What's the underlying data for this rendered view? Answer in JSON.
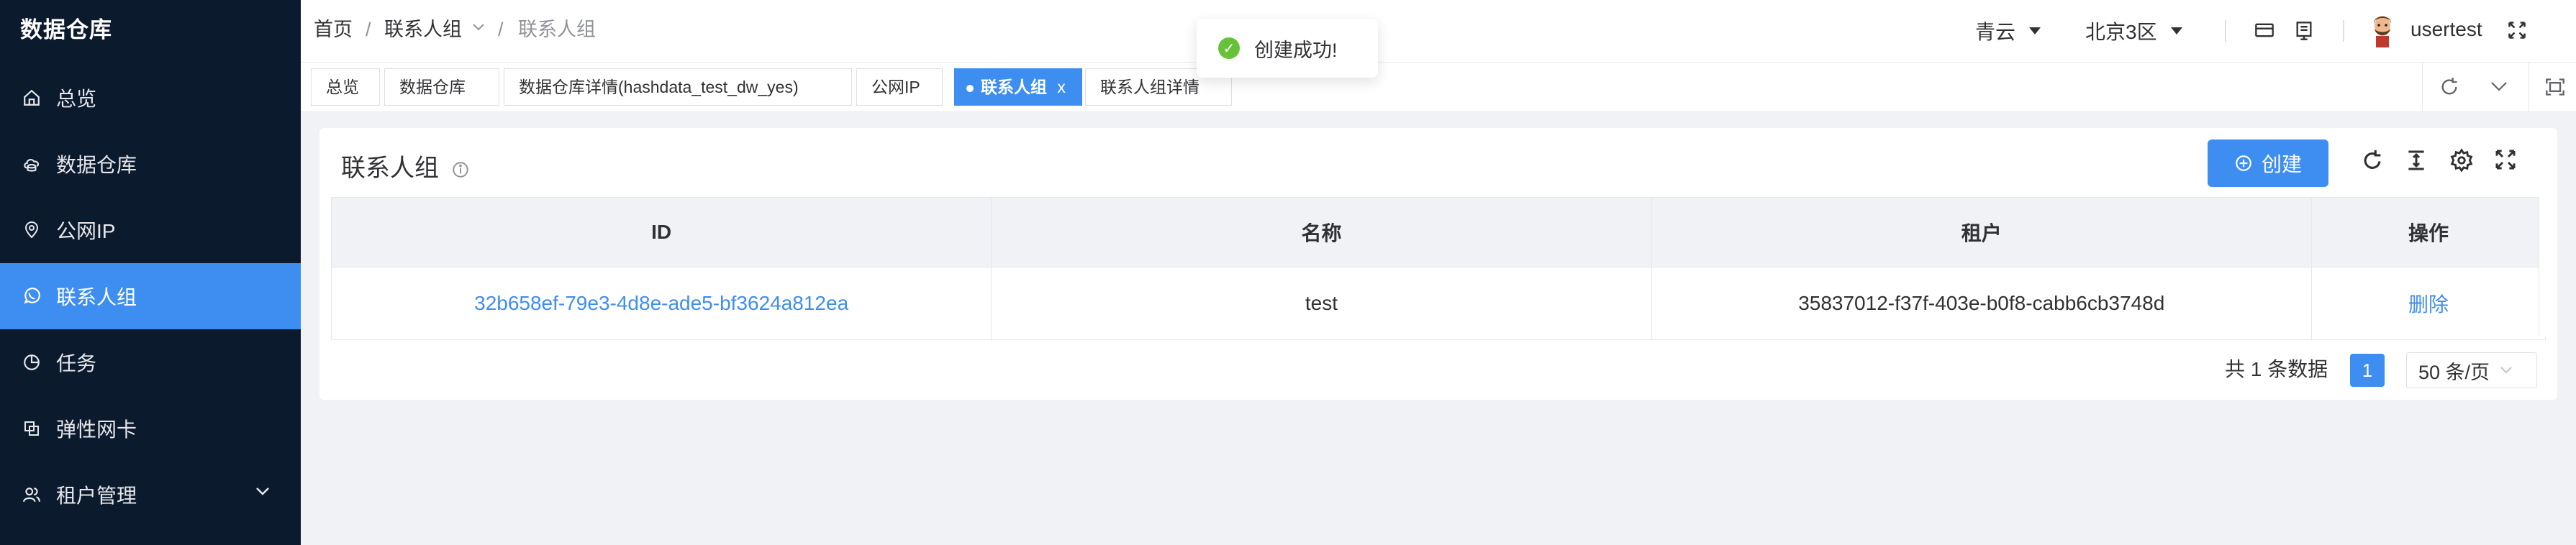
{
  "sidebar": {
    "title": "数据仓库",
    "items": [
      {
        "label": "总览",
        "icon": "home-icon"
      },
      {
        "label": "数据仓库",
        "icon": "cloud-database-icon"
      },
      {
        "label": "公网IP",
        "icon": "location-pin-icon"
      },
      {
        "label": "联系人组",
        "icon": "whatsapp-chat-icon"
      },
      {
        "label": "任务",
        "icon": "pie-chart-icon"
      },
      {
        "label": "弹性网卡",
        "icon": "copy-cards-icon"
      },
      {
        "label": "租户管理",
        "icon": "users-icon"
      }
    ]
  },
  "breadcrumb": {
    "home": "首页",
    "sep": "/",
    "section": "联系人组",
    "current": "联系人组"
  },
  "toast": {
    "message": "创建成功!"
  },
  "header": {
    "cloud": "青云",
    "region": "北京3区",
    "username": "usertest"
  },
  "tabs": [
    {
      "label": "总览"
    },
    {
      "label": "数据仓库"
    },
    {
      "label": "数据仓库详情(hashdata_test_dw_yes)"
    },
    {
      "label": "公网IP"
    },
    {
      "label": "联系人组",
      "close": "x"
    },
    {
      "label": "联系人组详情"
    }
  ],
  "card": {
    "title": "联系人组",
    "create_label": "创建"
  },
  "table": {
    "columns": [
      "ID",
      "名称",
      "租户",
      "操作"
    ],
    "rows": [
      {
        "id": "32b658ef-79e3-4d8e-ade5-bf3624a812ea",
        "name": "test",
        "tenant": "35837012-f37f-403e-b0f8-cabb6cb3748d",
        "action": "删除"
      }
    ]
  },
  "pagination": {
    "total": "共 1 条数据",
    "page": "1",
    "page_size": "50 条/页"
  },
  "colors": {
    "sidebar_bg": "#0c1a2e",
    "accent": "#3d8ef0",
    "success": "#67c23a"
  }
}
